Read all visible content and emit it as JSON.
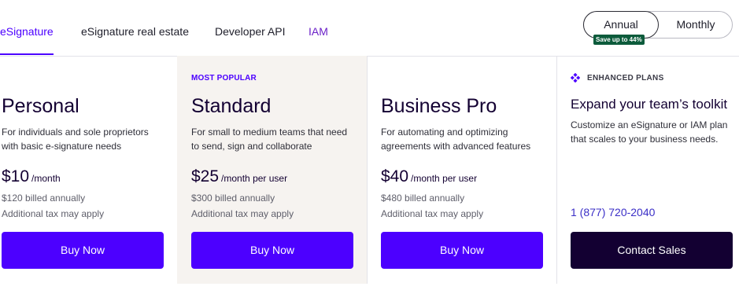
{
  "tabs": [
    {
      "label": "eSignature"
    },
    {
      "label": "eSignature real estate"
    },
    {
      "label": "Developer API"
    },
    {
      "label": "IAM"
    }
  ],
  "billing_toggle": {
    "annual": "Annual",
    "monthly": "Monthly",
    "save_badge": "Save up to 44%",
    "selected": "Annual"
  },
  "plans": [
    {
      "title": "Personal",
      "description": "For individuals and sole proprietors with basic e-signature needs",
      "price": "$10",
      "unit": "/month",
      "billed": "$120 billed annually",
      "tax": "Additional tax may apply",
      "button": "Buy Now"
    },
    {
      "badge": "MOST POPULAR",
      "title": "Standard",
      "description": "For small to medium teams that need to send, sign and collaborate",
      "price": "$25",
      "unit": "/month per user",
      "billed": "$300 billed annually",
      "tax": "Additional tax may apply",
      "button": "Buy Now"
    },
    {
      "title": "Business Pro",
      "description": "For automating and optimizing agreements with advanced features",
      "price": "$40",
      "unit": "/month per user",
      "billed": "$480 billed annually",
      "tax": "Additional tax may apply",
      "button": "Buy Now"
    }
  ],
  "enhanced": {
    "icon": "diamond-cluster-icon",
    "label": "ENHANCED PLANS",
    "title": "Expand your team’s toolkit",
    "description": "Customize an eSignature or IAM plan that scales to your business needs.",
    "phone": "1 (877) 720-2040",
    "button": "Contact Sales"
  },
  "colors": {
    "accent": "#4c00ff",
    "dark_button": "#130032",
    "badge_green": "#0c5b3b",
    "highlight_column": "#f6f3f0"
  }
}
